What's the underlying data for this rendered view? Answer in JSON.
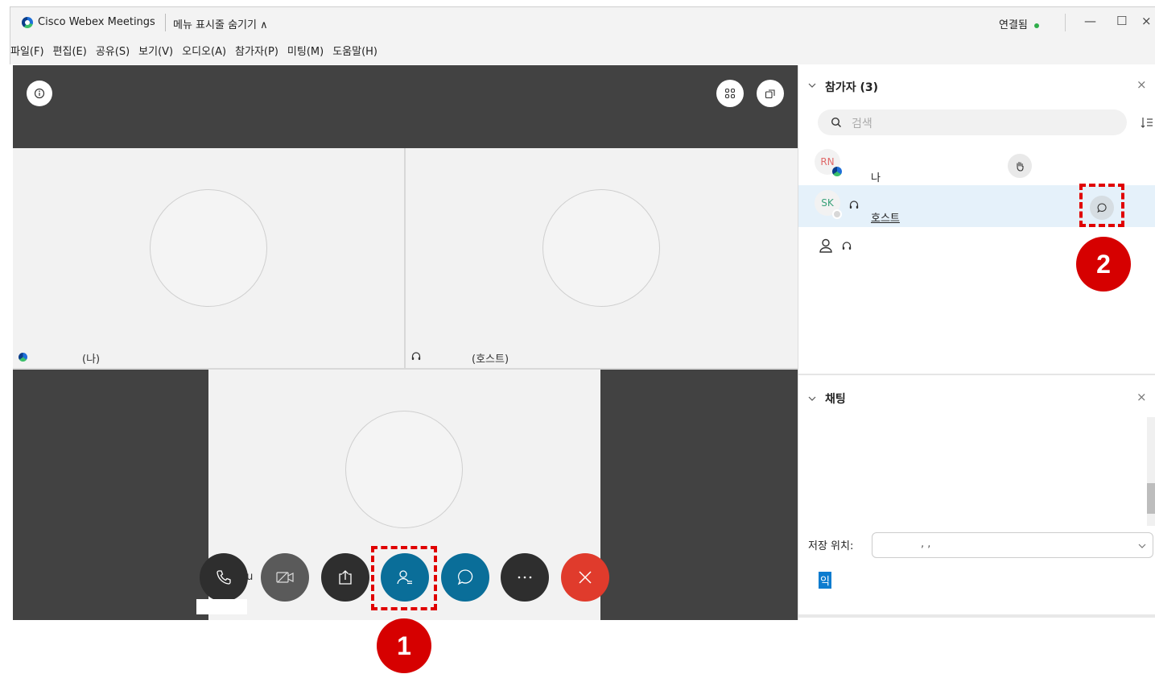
{
  "window": {
    "app_title": "Cisco Webex Meetings",
    "menu_toggle": "메뉴 표시줄 숨기기 ∧",
    "status": "연결됨",
    "minimize": "—",
    "maximize": "☐",
    "close": "×"
  },
  "menu": {
    "items": [
      "파일(F)",
      "편집(E)",
      "공유(S)",
      "보기(V)",
      "오디오(A)",
      "참가자(P)",
      "미팅(M)",
      "도움말(H)"
    ]
  },
  "video": {
    "tiles": [
      {
        "label": "(나)"
      },
      {
        "label": "(호스트)"
      },
      {
        "label": "tu"
      }
    ],
    "controls": [
      "phone-icon",
      "camera-off-icon",
      "share-icon",
      "participants-icon",
      "chat-icon",
      "more-icon",
      "end-meeting-icon"
    ]
  },
  "participants": {
    "header": "참가자 (3)",
    "close": "×",
    "search_placeholder": "검색",
    "rows": [
      {
        "initials": "RN",
        "name": "나"
      },
      {
        "initials": "SK",
        "name": "호스트"
      },
      {
        "initials": "",
        "name": ""
      }
    ]
  },
  "chat": {
    "header": "채팅",
    "close": "×",
    "save_label": "저장 위치:",
    "save_value": ",      ,",
    "highlighted": "익"
  },
  "annotations": {
    "badge1": "1",
    "badge2": "2",
    "color": "#e00000"
  },
  "colors": {
    "webex_blue": "#0a6e99",
    "end_red": "#e03b2c",
    "dark": "#424242"
  }
}
